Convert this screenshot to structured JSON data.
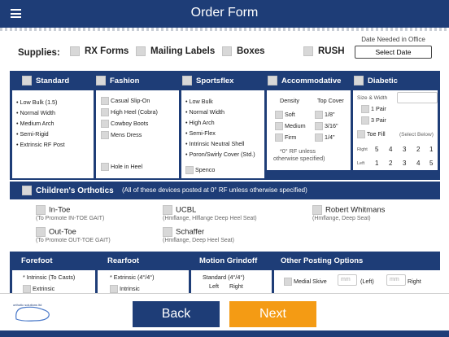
{
  "header": {
    "title": "Order Form",
    "menu_icon": "hamburger-menu-icon"
  },
  "supplies": {
    "label": "Supplies:",
    "items": [
      "RX Forms",
      "Mailing Labels",
      "Boxes",
      "RUSH"
    ],
    "date_label": "Date Needed in Office",
    "date_button": "Select Date"
  },
  "columns": {
    "standard": {
      "title": "Standard",
      "lines": [
        "• Low Bulk (1.5)",
        "• Normal Width",
        "• Medium Arch",
        "• Semi-Rigid",
        "• Extrinsic RF Post"
      ]
    },
    "fashion": {
      "title": "Fashion",
      "options": [
        "Casual Slip-On",
        "High Heel (Cobra)",
        "Cowboy Boots",
        "Mens Dress"
      ],
      "extra": "Hole in Heel"
    },
    "sportsflex": {
      "title": "Sportsflex",
      "lines": [
        "• Low Bulk",
        "• Normal Width",
        "• High Arch",
        "• Semi-Flex",
        "• Intrinsic Neutral Shell",
        "• Poron/Swirly Cover (Std.)"
      ],
      "extra": "Spenco"
    },
    "accommodative": {
      "title": "Accommodative",
      "density_label": "Density",
      "topcover_label": "Top Cover",
      "density": [
        "Soft",
        "Medium",
        "Firm"
      ],
      "topcover": [
        "1/8\"",
        "3/16\"",
        "1/4\""
      ],
      "note1": "*0° RF unless",
      "note2": "otherwise specified)"
    },
    "diabetic": {
      "title": "Diabetic",
      "size_label": "Size & Width",
      "pair1": "1 Pair",
      "pair3": "3 Pair",
      "toefill": "Toe Fill",
      "select_below": "(Select Below)",
      "right_label": "Right",
      "left_label": "Left",
      "right_nums": [
        "5",
        "4",
        "3",
        "2",
        "1"
      ],
      "left_nums": [
        "1",
        "2",
        "3",
        "4",
        "5"
      ]
    }
  },
  "childrens": {
    "title": "Children's Orthotics",
    "note": "(All of these devices posted at 0° RF unless otherwise specified)",
    "options": [
      {
        "name": "In-Toe",
        "sub": "(To Promote IN-TOE GAIT)"
      },
      {
        "name": "UCBL",
        "sub": "(Hmflange, Hlflange Deep Heel Seat)"
      },
      {
        "name": "Robert Whitmans",
        "sub": "(Hmflange, Deep Seat)"
      },
      {
        "name": "Out-Toe",
        "sub": "(To Promote OUT-TOE GAIT)"
      },
      {
        "name": "Schaffer",
        "sub": "(Hmflange, Deep Heel Seat)"
      }
    ]
  },
  "bottom": {
    "headers": [
      "Forefoot",
      "Rearfoot",
      "Motion Grindoff",
      "Other Posting Options"
    ],
    "forefoot": [
      "* Intrinsic (To Casts)",
      "Extrinsic"
    ],
    "rearfoot": [
      "* Extrinsic (4°/4°)",
      "Intrinsic"
    ],
    "motion": {
      "standard": "Standard (4°/4°)",
      "left": "Left",
      "right": "Right"
    },
    "other": {
      "medial_skive": "Medial Skive",
      "mm": "mm",
      "left": "(Left)",
      "right": "Right"
    }
  },
  "footer": {
    "back": "Back",
    "next": "Next",
    "logo_text": "orthotic solutions ltd"
  }
}
